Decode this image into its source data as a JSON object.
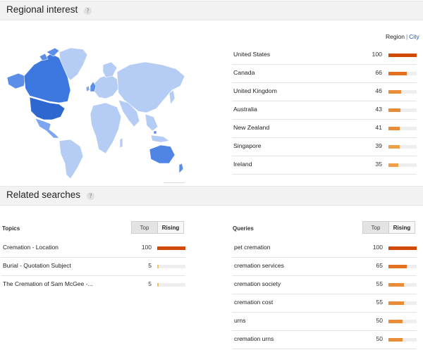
{
  "regional": {
    "title": "Regional interest",
    "toggle": {
      "region": "Region",
      "city": "City"
    },
    "rows": [
      {
        "label": "United States",
        "value": "100",
        "pct": 1.0,
        "color": "#d04a02"
      },
      {
        "label": "Canada",
        "value": "66",
        "pct": 0.66,
        "color": "#e3701f"
      },
      {
        "label": "United Kingdom",
        "value": "46",
        "pct": 0.46,
        "color": "#eb8c36"
      },
      {
        "label": "Australia",
        "value": "43",
        "pct": 0.43,
        "color": "#eb8c36"
      },
      {
        "label": "New Zealand",
        "value": "41",
        "pct": 0.41,
        "color": "#eb8c36"
      },
      {
        "label": "Singapore",
        "value": "39",
        "pct": 0.39,
        "color": "#f0a04a"
      },
      {
        "label": "Ireland",
        "value": "35",
        "pct": 0.35,
        "color": "#f0a04a"
      }
    ],
    "map_colors": {
      "land": "#b5cdf5",
      "border": "#ffffff",
      "high": "#3c78e0",
      "mid": "#5a8ee8",
      "mid2": "#7ea6ee"
    }
  },
  "related": {
    "title": "Related searches",
    "topics": {
      "label": "Topics",
      "tabs": {
        "top": "Top",
        "rising": "Rising"
      },
      "rows": [
        {
          "label": "Cremation - Location",
          "value": "100",
          "pct": 1.0,
          "color": "#d04a02"
        },
        {
          "label": "Burial - Quotation Subject",
          "value": "5",
          "pct": 0.05,
          "color": "#f5c060"
        },
        {
          "label": "The Cremation of Sam McGee -...",
          "value": "5",
          "pct": 0.05,
          "color": "#f5c060"
        }
      ]
    },
    "queries": {
      "label": "Queries",
      "tabs": {
        "top": "Top",
        "rising": "Rising"
      },
      "rows": [
        {
          "label": "pet cremation",
          "value": "100",
          "pct": 1.0,
          "color": "#d04a02"
        },
        {
          "label": "cremation services",
          "value": "65",
          "pct": 0.65,
          "color": "#e3701f"
        },
        {
          "label": "cremation society",
          "value": "55",
          "pct": 0.55,
          "color": "#eb8c36"
        },
        {
          "label": "cremation cost",
          "value": "55",
          "pct": 0.55,
          "color": "#eb8c36"
        },
        {
          "label": "urns",
          "value": "50",
          "pct": 0.5,
          "color": "#eb8c36"
        },
        {
          "label": "cremation urns",
          "value": "50",
          "pct": 0.5,
          "color": "#eb8c36"
        }
      ]
    }
  },
  "icons": {
    "help": "help-icon"
  }
}
